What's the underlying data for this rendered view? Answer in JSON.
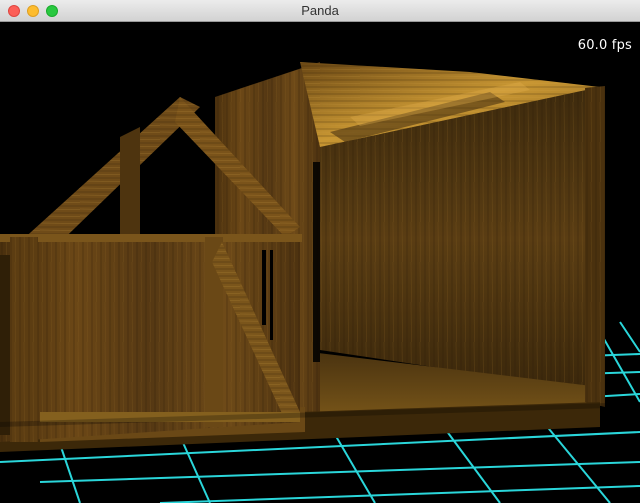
{
  "window": {
    "title": "Panda"
  },
  "hud": {
    "fps": "60.0 fps"
  },
  "scene": {
    "background": "#000000",
    "grid_color": "#2de2e6",
    "wood_dark": "#3a260c",
    "wood_mid": "#6a4a18",
    "wood_light": "#b8862c"
  }
}
